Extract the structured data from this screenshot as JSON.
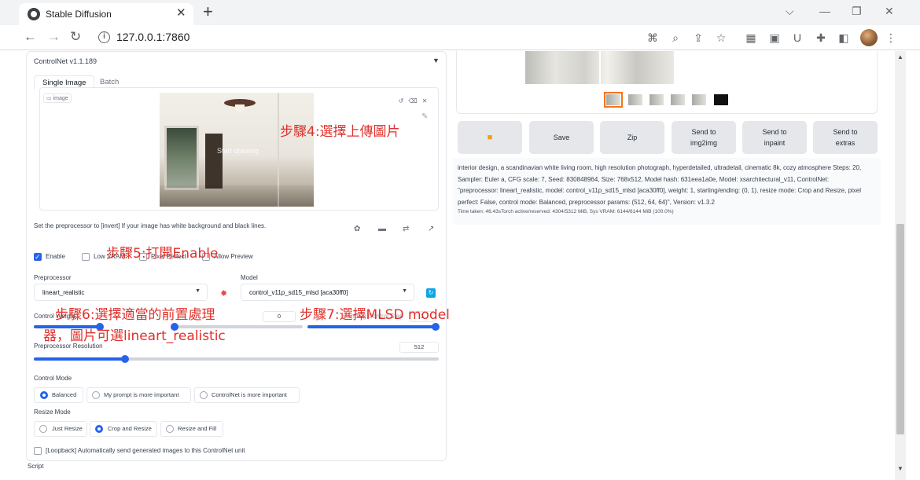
{
  "browser": {
    "tab_title": "Stable Diffusion",
    "tab_close": "✕",
    "new_tab": "+",
    "url": "127.0.0.1:7860"
  },
  "controlnet": {
    "title": "ControlNet v1.1.189",
    "collapse_icon": "▼",
    "tabs": [
      "Single Image",
      "Batch"
    ],
    "image_label": "image",
    "start_drawing": "Start drawing",
    "note": "Set the preprocessor to [invert] If your image has white background and black lines.",
    "checkboxes": [
      {
        "label": "Enable",
        "checked": true
      },
      {
        "label": "Low VRAM",
        "checked": false
      },
      {
        "label": "Pixel Perfect",
        "checked": false
      },
      {
        "label": "Allow Preview",
        "checked": false
      }
    ],
    "preprocessor_label": "Preprocessor",
    "preprocessor_value": "lineart_realistic",
    "model_label": "Model",
    "model_value": "control_v11p_sd15_mlsd [aca30ff0]",
    "control_weight_label": "Control Weight",
    "starting_step_value": "0",
    "ending_step_label": "Ending Control Step",
    "ending_step_value": "1",
    "preprocessor_resolution_label": "Preprocessor Resolution",
    "preprocessor_resolution_value": "512",
    "control_mode_label": "Control Mode",
    "control_modes": [
      "Balanced",
      "My prompt is more important",
      "ControlNet is more important"
    ],
    "control_mode_selected": "Balanced",
    "resize_mode_label": "Resize Mode",
    "resize_modes": [
      "Just Resize",
      "Crop and Resize",
      "Resize and Fill"
    ],
    "resize_mode_selected": "Crop and Resize",
    "loopback_label": "[Loopback] Automatically send generated images to this ControlNet unit",
    "script_label": "Script"
  },
  "sliders": {
    "control_weight": 1.0,
    "starting_step": 0.0,
    "ending_step": 1.0,
    "preprocessor_resolution": 512
  },
  "annotations": {
    "step4": "步驟4:選擇上傳圖片",
    "step5": "步驟5:打開Enable",
    "step6_line1": "步驟6:選擇適當的前置處理",
    "step6_line2": "器，圖片可選lineart_realistic",
    "step7": "步驟7:選擇MLSD model"
  },
  "output": {
    "buttons": [
      {
        "label": "",
        "icon": "folder-icon"
      },
      {
        "label": "Save"
      },
      {
        "label": "Zip"
      },
      {
        "label": "Send to img2img"
      },
      {
        "label": "Send to inpaint"
      },
      {
        "label": "Send to extras"
      }
    ],
    "info": "interior design, a scandinavian white living room, high resolution photograph, hyperdetailed, ultradetail, cinematic 8k, cozy atmosphere Steps: 20, Sampler: Euler a, CFG scale: 7, Seed: 830848964, Size: 768x512, Model hash: 631eea1a0e, Model: xsarchitectural_v11, ControlNet: \"preprocessor: lineart_realistic, model: control_v11p_sd15_mlsd [aca30ff0], weight: 1, starting/ending: (0, 1), resize mode: Crop and Resize, pixel perfect: False, control mode: Balanced, preprocessor params: (512, 64, 64)\", Version: v1.3.2",
    "time": "Time taken: 46.43sTorch active/reserved: 4304/5312 MiB, Sys VRAM: 6144/6144 MiB (100.0%)"
  },
  "colors": {
    "accent": "#2563eb",
    "annotation": "#e0302b",
    "thumb_selected": "#f97316"
  }
}
